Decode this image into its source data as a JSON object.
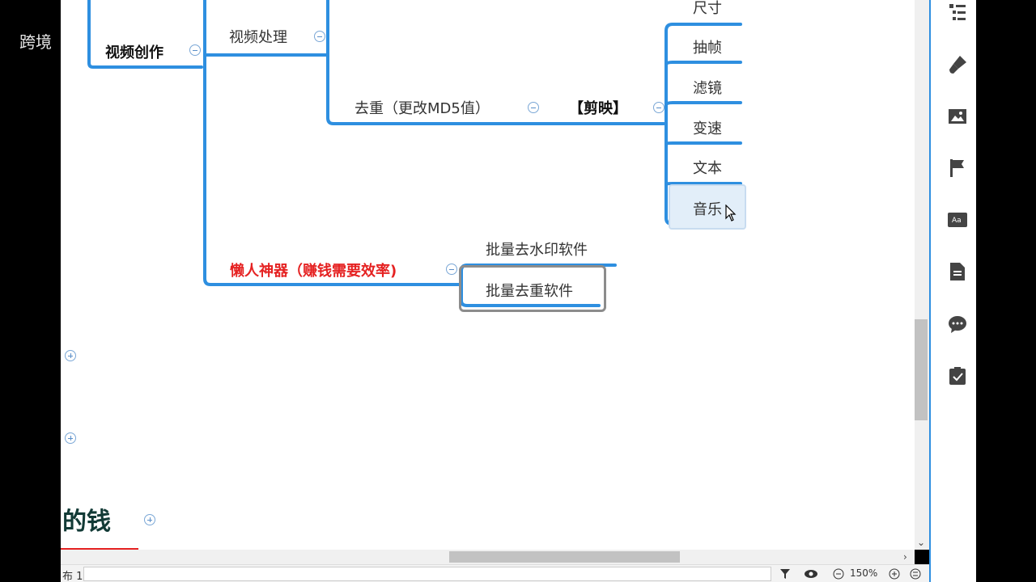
{
  "watermark": "跨境",
  "mindmap": {
    "video_creation": "视频创作",
    "video_processing": "视频处理",
    "dedupe_md5": "去重（更改MD5值）",
    "jianying": "【剪映】",
    "jy_items": [
      "尺寸",
      "抽帧",
      "滤镜",
      "变速",
      "文本",
      "音乐"
    ],
    "lazy_tools": "懒人神器（赚钱需要效率)",
    "batch_watermark": "批量去水印软件",
    "batch_dedupe": "批量去重软件",
    "money_heading": "的钱"
  },
  "statusbar": {
    "sheet": "布 1",
    "zoom": "150%"
  },
  "colors": {
    "branch": "#2e8fe0",
    "sidebar_border": "#2e8fe0",
    "red_text": "#e52222",
    "heading_underline": "#e52222"
  },
  "icons": [
    "outline-icon",
    "format-brush-icon",
    "image-icon",
    "flag-icon",
    "text-style-icon",
    "note-icon",
    "comment-icon",
    "task-icon",
    "filter-icon",
    "eye-icon",
    "zoom-out-icon",
    "zoom-in-icon",
    "fit-icon"
  ]
}
